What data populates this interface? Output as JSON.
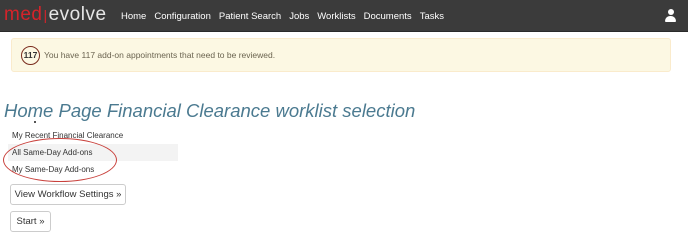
{
  "navbar": {
    "brand_left": "med",
    "brand_separator": "|",
    "brand_right": "evolve",
    "items": [
      "Home",
      "Configuration",
      "Patient Search",
      "Jobs",
      "Worklists",
      "Documents",
      "Tasks"
    ],
    "user_icon": "user-icon",
    "background_color": "#3b3b3b",
    "brand_accent_color": "#d5232a"
  },
  "alert": {
    "count": "117",
    "message": "You have 117 add-on appointments that need to be reviewed.",
    "background_color": "#fcf8e3"
  },
  "page": {
    "title": "Home Page Financial Clearance worklist selection",
    "title_color": "#4b7a90"
  },
  "worklist": {
    "items": [
      "My Recent Financial Clearance",
      "All Same-Day Add-ons",
      "My Same-Day Add-ons"
    ],
    "selected": "All Same-Day Add-ons",
    "annotation_color": "#c9413c"
  },
  "actions": {
    "workflow_settings_label": "View Workflow Settings »",
    "start_label": "Start »"
  }
}
